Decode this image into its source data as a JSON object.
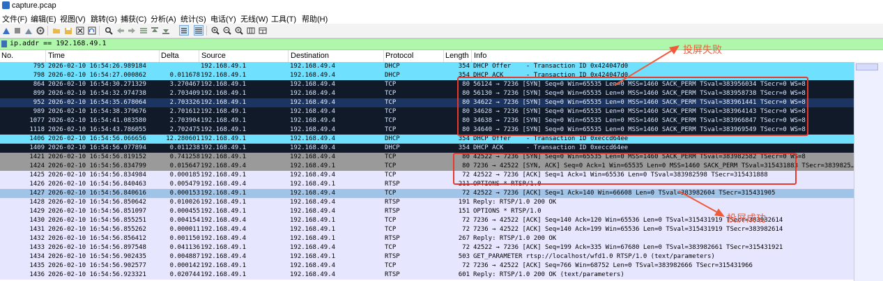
{
  "window": {
    "title": "capture.pcap"
  },
  "menu": [
    "文件(F)",
    "编辑(E)",
    "视图(V)",
    "跳转(G)",
    "捕获(C)",
    "分析(A)",
    "统计(S)",
    "电话(Y)",
    "无线(W)",
    "工具(T)",
    "帮助(H)"
  ],
  "toolbar": {
    "icons": [
      "shark-fin-start-icon",
      "stop-icon",
      "restart-icon",
      "options-icon",
      "open-folder-icon",
      "save-icon",
      "close-file-icon",
      "reload-icon",
      "find-icon",
      "back-icon",
      "forward-icon",
      "goto-packet-icon",
      "first-packet-icon",
      "last-packet-icon",
      "autoscroll-icon",
      "colorize-icon",
      "zoom-in-icon",
      "zoom-out-icon",
      "normal-size-icon",
      "resize-columns-icon"
    ]
  },
  "filter": {
    "value": "ip.addr == 192.168.49.1"
  },
  "columns": {
    "no": "No.",
    "time": "Time",
    "delta": "Delta",
    "source": "Source",
    "destination": "Destination",
    "protocol": "Protocol",
    "length": "Length",
    "info": "Info"
  },
  "colors": {
    "udp_cyan": "#70e0ff",
    "dark_bg": "#101a28",
    "dark_sel": "#1c3462",
    "gray": "#9a9a9a",
    "tcp_lav": "#e7e6ff",
    "selected": "#9fc4e8",
    "annot": "#e8392a"
  },
  "packets": [
    {
      "no": "795",
      "time": "2026-02-10 16:54:26.989184",
      "delta": "",
      "src": "192.168.49.1",
      "dst": "192.168.49.4",
      "proto": "DHCP",
      "len": "354",
      "info": "DHCP Offer    - Transaction ID 0x424047d0",
      "style": "cyan"
    },
    {
      "no": "798",
      "time": "2026-02-10 16:54:27.000862",
      "delta": "0.011678",
      "src": "192.168.49.1",
      "dst": "192.168.49.4",
      "proto": "DHCP",
      "len": "354",
      "info": "DHCP ACK      - Transaction ID 0x424047d0",
      "style": "cyan"
    },
    {
      "no": "864",
      "time": "2026-02-10 16:54:30.271329",
      "delta": "3.270467",
      "src": "192.168.49.1",
      "dst": "192.168.49.4",
      "proto": "TCP",
      "len": "80",
      "info": "56124 → 7236 [SYN] Seq=0 Win=65535 Len=0 MSS=1460 SACK_PERM TSval=383956034 TSecr=0 WS=8",
      "style": "dark"
    },
    {
      "no": "899",
      "time": "2026-02-10 16:54:32.974738",
      "delta": "2.703409",
      "src": "192.168.49.1",
      "dst": "192.168.49.4",
      "proto": "TCP",
      "len": "80",
      "info": "56130 → 7236 [SYN] Seq=0 Win=65535 Len=0 MSS=1460 SACK_PERM TSval=383958738 TSecr=0 WS=8",
      "style": "dark"
    },
    {
      "no": "952",
      "time": "2026-02-10 16:54:35.678064",
      "delta": "2.703326",
      "src": "192.168.49.1",
      "dst": "192.168.49.4",
      "proto": "TCP",
      "len": "80",
      "info": "34622 → 7236 [SYN] Seq=0 Win=65535 Len=0 MSS=1460 SACK_PERM TSval=383961441 TSecr=0 WS=8",
      "style": "darksel"
    },
    {
      "no": "989",
      "time": "2026-02-10 16:54:38.379676",
      "delta": "2.701612",
      "src": "192.168.49.1",
      "dst": "192.168.49.4",
      "proto": "TCP",
      "len": "80",
      "info": "34628 → 7236 [SYN] Seq=0 Win=65535 Len=0 MSS=1460 SACK_PERM TSval=383964143 TSecr=0 WS=8",
      "style": "dark"
    },
    {
      "no": "1077",
      "time": "2026-02-10 16:54:41.083580",
      "delta": "2.703904",
      "src": "192.168.49.1",
      "dst": "192.168.49.4",
      "proto": "TCP",
      "len": "80",
      "info": "34638 → 7236 [SYN] Seq=0 Win=65535 Len=0 MSS=1460 SACK_PERM TSval=383966847 TSecr=0 WS=8",
      "style": "dark"
    },
    {
      "no": "1118",
      "time": "2026-02-10 16:54:43.786055",
      "delta": "2.702475",
      "src": "192.168.49.1",
      "dst": "192.168.49.4",
      "proto": "TCP",
      "len": "80",
      "info": "34640 → 7236 [SYN] Seq=0 Win=65535 Len=0 MSS=1460 SACK_PERM TSval=383969549 TSecr=0 WS=8",
      "style": "dark"
    },
    {
      "no": "1406",
      "time": "2026-02-10 16:54:56.066656",
      "delta": "12.280601",
      "src": "192.168.49.1",
      "dst": "192.168.49.4",
      "proto": "DHCP",
      "len": "354",
      "info": "DHCP Offer    - Transaction ID 0xeccd64ee",
      "style": "cyan"
    },
    {
      "no": "1409",
      "time": "2026-02-10 16:54:56.077894",
      "delta": "0.011238",
      "src": "192.168.49.1",
      "dst": "192.168.49.4",
      "proto": "DHCP",
      "len": "354",
      "info": "DHCP ACK      - Transaction ID 0xeccd64ee",
      "style": "dark"
    },
    {
      "no": "1421",
      "time": "2026-02-10 16:54:56.819152",
      "delta": "0.741258",
      "src": "192.168.49.1",
      "dst": "192.168.49.4",
      "proto": "TCP",
      "len": "80",
      "info": "42522 → 7236 [SYN] Seq=0 Win=65535 Len=0 MSS=1460 SACK_PERM TSval=383982582 TSecr=0 WS=8",
      "style": "gray"
    },
    {
      "no": "1424",
      "time": "2026-02-10 16:54:56.834799",
      "delta": "0.015647",
      "src": "192.168.49.4",
      "dst": "192.168.49.1",
      "proto": "TCP",
      "len": "80",
      "info": "7236 → 42522 [SYN, ACK] Seq=0 Ack=1 Win=65535 Len=0 MSS=1460 SACK_PERM TSval=315431883 TSecr=3839825…",
      "style": "gray"
    },
    {
      "no": "1425",
      "time": "2026-02-10 16:54:56.834984",
      "delta": "0.000185",
      "src": "192.168.49.1",
      "dst": "192.168.49.4",
      "proto": "TCP",
      "len": "72",
      "info": "42522 → 7236 [ACK] Seq=1 Ack=1 Win=65536 Len=0 TSval=383982598 TSecr=315431888",
      "style": "lav"
    },
    {
      "no": "1426",
      "time": "2026-02-10 16:54:56.840463",
      "delta": "0.005479",
      "src": "192.168.49.4",
      "dst": "192.168.49.1",
      "proto": "RTSP",
      "len": "211",
      "info": "OPTIONS * RTSP/1.0",
      "style": "lav"
    },
    {
      "no": "1427",
      "time": "2026-02-10 16:54:56.840616",
      "delta": "0.000153",
      "src": "192.168.49.1",
      "dst": "192.168.49.4",
      "proto": "TCP",
      "len": "72",
      "info": "42522 → 7236 [ACK] Seq=1 Ack=140 Win=66608 Len=0 TSval=383982604 TSecr=315431905",
      "style": "selected"
    },
    {
      "no": "1428",
      "time": "2026-02-10 16:54:56.850642",
      "delta": "0.010026",
      "src": "192.168.49.1",
      "dst": "192.168.49.4",
      "proto": "RTSP",
      "len": "191",
      "info": "Reply: RTSP/1.0 200 OK",
      "style": "lav"
    },
    {
      "no": "1429",
      "time": "2026-02-10 16:54:56.851097",
      "delta": "0.000455",
      "src": "192.168.49.1",
      "dst": "192.168.49.4",
      "proto": "RTSP",
      "len": "151",
      "info": "OPTIONS * RTSP/1.0",
      "style": "lav"
    },
    {
      "no": "1430",
      "time": "2026-02-10 16:54:56.855251",
      "delta": "0.004154",
      "src": "192.168.49.4",
      "dst": "192.168.49.1",
      "proto": "TCP",
      "len": "72",
      "info": "7236 → 42522 [ACK] Seq=140 Ack=120 Win=65536 Len=0 TSval=315431919 TSecr=383982614",
      "style": "lav"
    },
    {
      "no": "1431",
      "time": "2026-02-10 16:54:56.855262",
      "delta": "0.000011",
      "src": "192.168.49.4",
      "dst": "192.168.49.1",
      "proto": "TCP",
      "len": "72",
      "info": "7236 → 42522 [ACK] Seq=140 Ack=199 Win=65536 Len=0 TSval=315431919 TSecr=383982614",
      "style": "lav"
    },
    {
      "no": "1432",
      "time": "2026-02-10 16:54:56.856412",
      "delta": "0.001150",
      "src": "192.168.49.4",
      "dst": "192.168.49.1",
      "proto": "RTSP",
      "len": "267",
      "info": "Reply: RTSP/1.0 200 OK",
      "style": "lav"
    },
    {
      "no": "1433",
      "time": "2026-02-10 16:54:56.897548",
      "delta": "0.041136",
      "src": "192.168.49.1",
      "dst": "192.168.49.4",
      "proto": "TCP",
      "len": "72",
      "info": "42522 → 7236 [ACK] Seq=199 Ack=335 Win=67680 Len=0 TSval=383982661 TSecr=315431921",
      "style": "lav"
    },
    {
      "no": "1434",
      "time": "2026-02-10 16:54:56.902435",
      "delta": "0.004887",
      "src": "192.168.49.4",
      "dst": "192.168.49.1",
      "proto": "RTSP",
      "len": "503",
      "info": "GET_PARAMETER rtsp://localhost/wfd1.0 RTSP/1.0 (text/parameters)",
      "style": "lav"
    },
    {
      "no": "1435",
      "time": "2026-02-10 16:54:56.902577",
      "delta": "0.000142",
      "src": "192.168.49.1",
      "dst": "192.168.49.4",
      "proto": "TCP",
      "len": "72",
      "info": "7236 → 42522 [ACK] Seq=766 Win=68752 Len=0 TSval=383982666 TSecr=315431966",
      "style": "lav"
    },
    {
      "no": "1436",
      "time": "2026-02-10 16:54:56.923321",
      "delta": "0.020744",
      "src": "192.168.49.1",
      "dst": "192.168.49.4",
      "proto": "RTSP",
      "len": "601",
      "info": "Reply: RTSP/1.0 200 OK (text/parameters)",
      "style": "lav"
    }
  ],
  "annotations": {
    "fail_label": "投屏失败",
    "success_label": "投屏成功"
  }
}
